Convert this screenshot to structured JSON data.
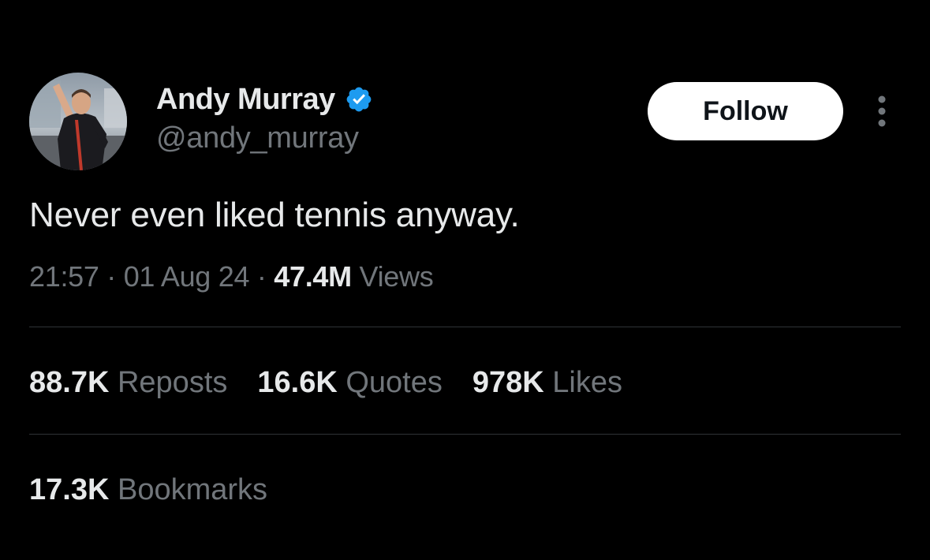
{
  "author": {
    "display_name": "Andy Murray",
    "handle": "@andy_murray",
    "verified_icon": "verified-badge-icon",
    "verified_color": "#1d9bf0"
  },
  "actions": {
    "follow_label": "Follow",
    "more_icon": "more-vertical-icon"
  },
  "tweet": {
    "text": "Never even liked tennis anyway."
  },
  "meta": {
    "time": "21:57",
    "separator": "·",
    "date": "01 Aug 24",
    "views_count": "47.4M",
    "views_label": "Views"
  },
  "stats": {
    "reposts_count": "88.7K",
    "reposts_label": "Reposts",
    "quotes_count": "16.6K",
    "quotes_label": "Quotes",
    "likes_count": "978K",
    "likes_label": "Likes",
    "bookmarks_count": "17.3K",
    "bookmarks_label": "Bookmarks"
  },
  "colors": {
    "background": "#000000",
    "primary_text": "#e7e9ea",
    "secondary_text": "#71767b",
    "divider": "#2f3336",
    "follow_bg": "#ffffff",
    "follow_text": "#0f1419"
  }
}
